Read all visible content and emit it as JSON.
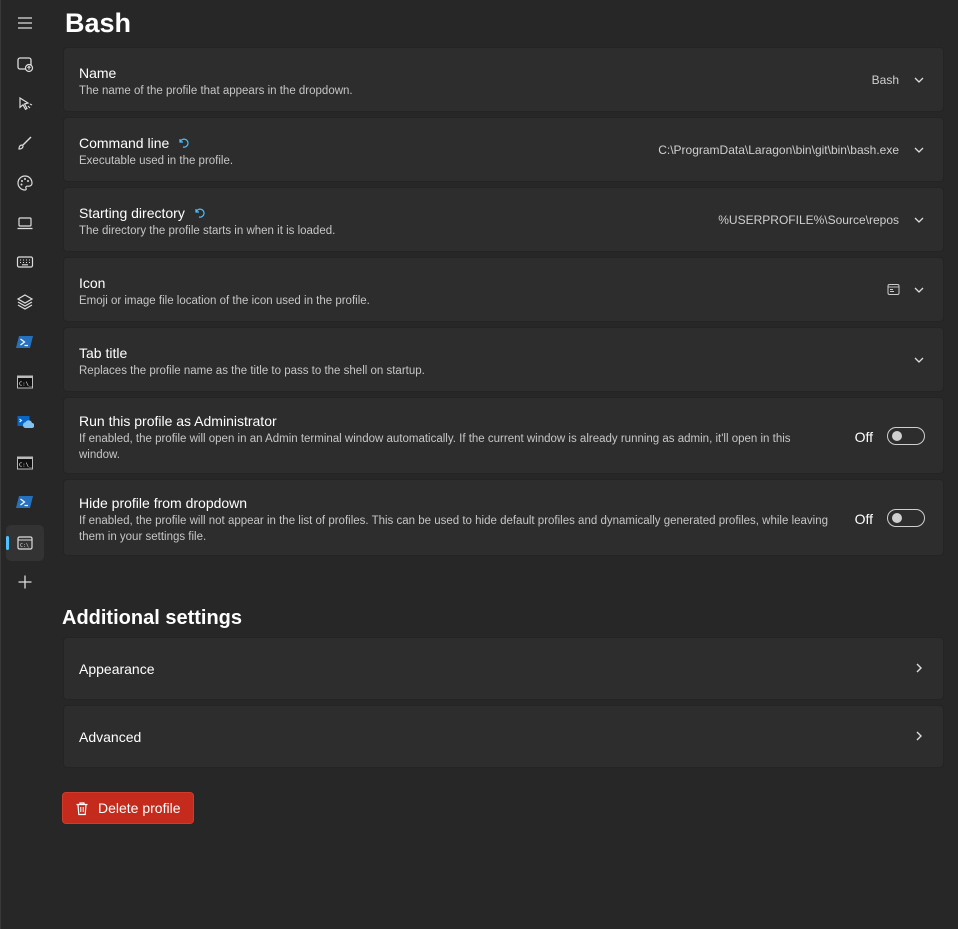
{
  "page": {
    "title": "Bash"
  },
  "sidebar": {
    "items": [
      {
        "icon": "hamburger-menu-icon"
      },
      {
        "icon": "startup-icon"
      },
      {
        "icon": "interaction-icon"
      },
      {
        "icon": "appearance-brush-icon"
      },
      {
        "icon": "color-schemes-palette-icon"
      },
      {
        "icon": "rendering-laptop-icon"
      },
      {
        "icon": "keyboard-icon"
      },
      {
        "icon": "defaults-layers-icon"
      },
      {
        "icon": "powershell-profile-icon"
      },
      {
        "icon": "command-prompt-profile-icon"
      },
      {
        "icon": "azure-cloud-shell-icon"
      },
      {
        "icon": "command-prompt-profile-icon"
      },
      {
        "icon": "powershell-profile-icon"
      },
      {
        "icon": "bash-profile-icon",
        "selected": true
      },
      {
        "icon": "add-profile-plus-icon"
      }
    ]
  },
  "settings": {
    "name": {
      "title": "Name",
      "description": "The name of the profile that appears in the dropdown.",
      "value": "Bash"
    },
    "command_line": {
      "title": "Command line",
      "description": "Executable used in the profile.",
      "value": "C:\\ProgramData\\Laragon\\bin\\git\\bin\\bash.exe"
    },
    "starting_directory": {
      "title": "Starting directory",
      "description": "The directory the profile starts in when it is loaded.",
      "value": "%USERPROFILE%\\Source\\repos"
    },
    "icon": {
      "title": "Icon",
      "description": "Emoji or image file location of the icon used in the profile."
    },
    "tab_title": {
      "title": "Tab title",
      "description": "Replaces the profile name as the title to pass to the shell on startup."
    },
    "run_as_admin": {
      "title": "Run this profile as Administrator",
      "description": "If enabled, the profile will open in an Admin terminal window automatically. If the current window is already running as admin, it'll open in this window.",
      "state": "Off"
    },
    "hide_profile": {
      "title": "Hide profile from dropdown",
      "description": "If enabled, the profile will not appear in the list of profiles. This can be used to hide default profiles and dynamically generated profiles, while leaving them in your settings file.",
      "state": "Off"
    }
  },
  "additional": {
    "title": "Additional settings",
    "appearance": "Appearance",
    "advanced": "Advanced"
  },
  "delete_button": {
    "label": "Delete profile"
  },
  "colors": {
    "accent": "#4cc2ff",
    "danger": "#c42b1c",
    "background": "#272727",
    "card": "#2d2d2d"
  }
}
